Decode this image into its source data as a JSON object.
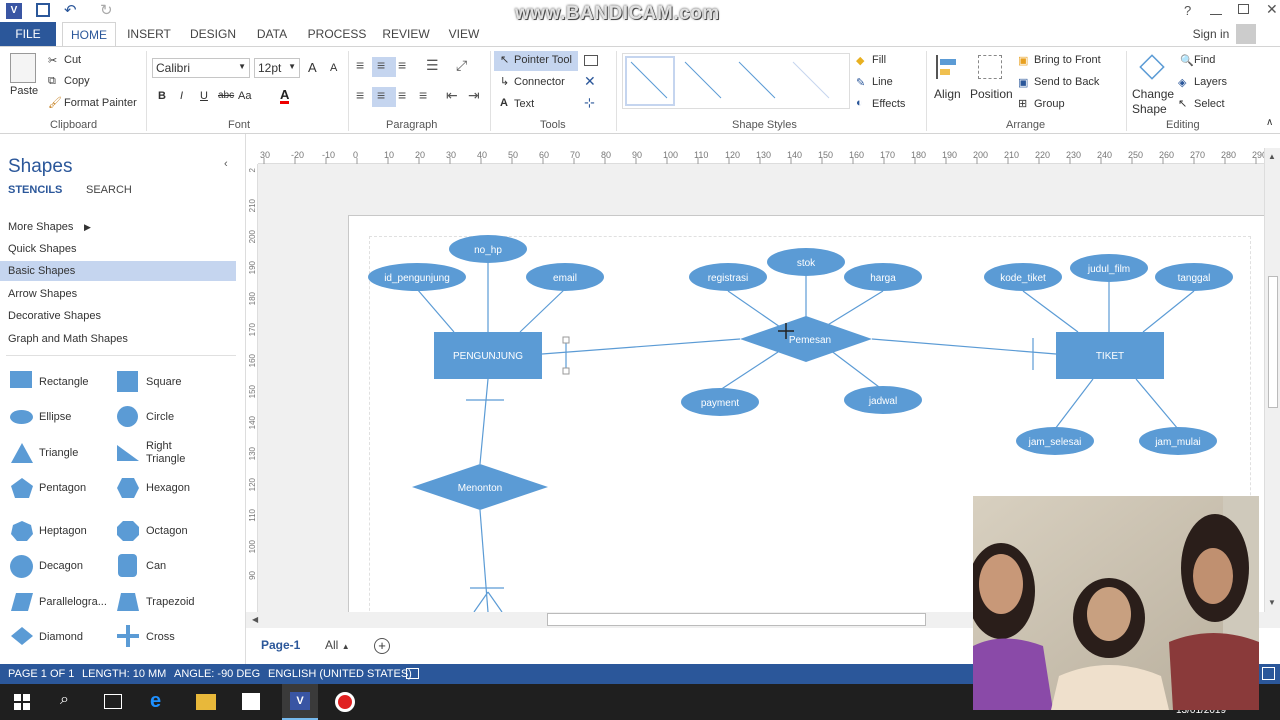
{
  "watermark": "www.BANDICAM.com",
  "titlebar": {
    "help": "?"
  },
  "tabs": [
    "FILE",
    "HOME",
    "INSERT",
    "DESIGN",
    "DATA",
    "PROCESS",
    "REVIEW",
    "VIEW"
  ],
  "signin": "Sign in",
  "ribbon": {
    "clipboard": {
      "paste": "Paste",
      "cut": "Cut",
      "copy": "Copy",
      "format_painter": "Format Painter",
      "label": "Clipboard"
    },
    "font": {
      "family": "Calibri",
      "size": "12pt",
      "label": "Font",
      "bold": "B",
      "italic": "I",
      "underline": "U",
      "strike": "abc",
      "case": "Aa",
      "grow": "A",
      "shrink": "A"
    },
    "paragraph": {
      "label": "Paragraph"
    },
    "tools": {
      "pointer": "Pointer Tool",
      "connector": "Connector",
      "text": "Text",
      "label": "Tools"
    },
    "shape_styles": {
      "label": "Shape Styles",
      "fill": "Fill",
      "line": "Line",
      "effects": "Effects"
    },
    "arrange": {
      "align": "Align",
      "position": "Position",
      "bring_front": "Bring to Front",
      "send_back": "Send to Back",
      "group": "Group",
      "label": "Arrange"
    },
    "editing": {
      "change_shape_1": "Change",
      "change_shape_2": "Shape",
      "find": "Find",
      "layers": "Layers",
      "select": "Select",
      "label": "Editing"
    }
  },
  "shapes_panel": {
    "title": "Shapes",
    "stencils": "STENCILS",
    "search": "SEARCH",
    "menu": [
      "More Shapes",
      "Quick Shapes",
      "Basic Shapes",
      "Arrow Shapes",
      "Decorative Shapes",
      "Graph and Math Shapes"
    ],
    "shapes": [
      "Rectangle",
      "Square",
      "Ellipse",
      "Circle",
      "Triangle",
      "Right Triangle",
      "Pentagon",
      "Hexagon",
      "Heptagon",
      "Octagon",
      "Decagon",
      "Can",
      "Parallelogra...",
      "Trapezoid",
      "Diamond",
      "Cross"
    ]
  },
  "ruler_top": [
    "30",
    "-20",
    "-10",
    "0",
    "10",
    "20",
    "30",
    "40",
    "50",
    "60",
    "70",
    "80",
    "90",
    "100",
    "110",
    "120",
    "130",
    "140",
    "150",
    "160",
    "170",
    "180",
    "190",
    "200",
    "210",
    "220",
    "230",
    "240",
    "250",
    "260",
    "270",
    "280",
    "290"
  ],
  "ruler_left": [
    "2",
    "210",
    "200",
    "190",
    "180",
    "170",
    "160",
    "150",
    "140",
    "130",
    "120",
    "110",
    "100",
    "90"
  ],
  "diagram": {
    "entities": [
      "PENGUNJUNG",
      "TIKET"
    ],
    "relations": [
      "Pemesan",
      "Menonton"
    ],
    "attributes": [
      "no_hp",
      "id_pengunjung",
      "email",
      "registrasi",
      "stok",
      "harga",
      "payment",
      "jadwal",
      "kode_tiket",
      "judul_film",
      "tanggal",
      "jam_selesai",
      "jam_mulai"
    ]
  },
  "pagetabs": {
    "page1": "Page-1",
    "all": "All"
  },
  "status": {
    "page": "PAGE 1 OF 1",
    "length": "LENGTH: 10 MM",
    "angle": "ANGLE: -90 DEG",
    "lang": "ENGLISH (UNITED STATES)"
  },
  "taskbar": {
    "date": "13/01/2019"
  },
  "colors": {
    "accent": "#2b579a",
    "shape": "#5b9bd5",
    "highlight": "#c5d5ef"
  }
}
